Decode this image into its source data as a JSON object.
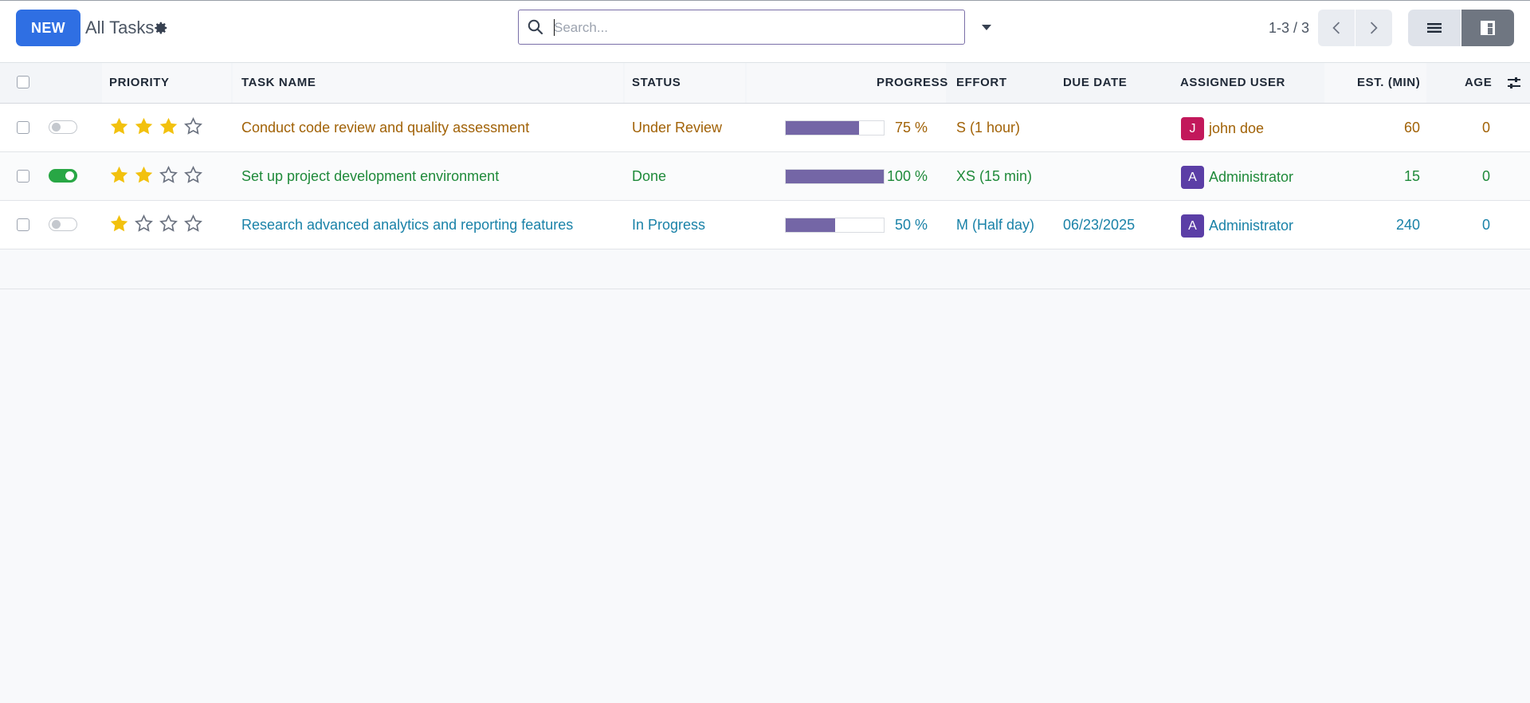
{
  "control_panel": {
    "new_label": "NEW",
    "title": "All Tasks",
    "search_placeholder": "Search...",
    "pager": "1-3 / 3"
  },
  "columns": {
    "priority": "PRIORITY",
    "task_name": "TASK NAME",
    "status": "STATUS",
    "progress": "PROGRESS",
    "effort": "EFFORT",
    "due_date": "DUE DATE",
    "assigned_user": "ASSIGNED USER",
    "est_min": "EST. (MIN)",
    "age": "AGE"
  },
  "rows": [
    {
      "active": false,
      "stars": 3,
      "task": "Conduct code review and quality assessment",
      "status": "Under Review",
      "progress_value": 75,
      "progress_label": "75 %",
      "effort": "S (1 hour)",
      "due_date": "",
      "avatar_letter": "J",
      "avatar_color": "#c2185b",
      "user": "john doe",
      "est": "60",
      "age": "0",
      "color": "#a16207"
    },
    {
      "active": true,
      "stars": 2,
      "task": "Set up project development environment",
      "status": "Done",
      "progress_value": 100,
      "progress_label": "100 %",
      "effort": "XS (15 min)",
      "due_date": "",
      "avatar_letter": "A",
      "avatar_color": "#5b3ea6",
      "user": "Administrator",
      "est": "15",
      "age": "0",
      "color": "#1f8a3a"
    },
    {
      "active": false,
      "stars": 1,
      "task": "Research advanced analytics and reporting features",
      "status": "In Progress",
      "progress_value": 50,
      "progress_label": "50 %",
      "effort": "M (Half day)",
      "due_date": "06/23/2025",
      "avatar_letter": "A",
      "avatar_color": "#5b3ea6",
      "user": "Administrator",
      "est": "240",
      "age": "0",
      "color": "#1a82a8"
    }
  ],
  "colors": {
    "new_button": "#2f6fe3",
    "star_filled": "#f2c10e",
    "progress_fill": "#7466a6",
    "toggle_on": "#28a745"
  },
  "icons": [
    "gear-icon",
    "search-icon",
    "caret-down-icon",
    "chevron-left-icon",
    "chevron-right-icon",
    "list-view-icon",
    "kanban-view-icon",
    "optional-columns-icon",
    "star-icon"
  ]
}
